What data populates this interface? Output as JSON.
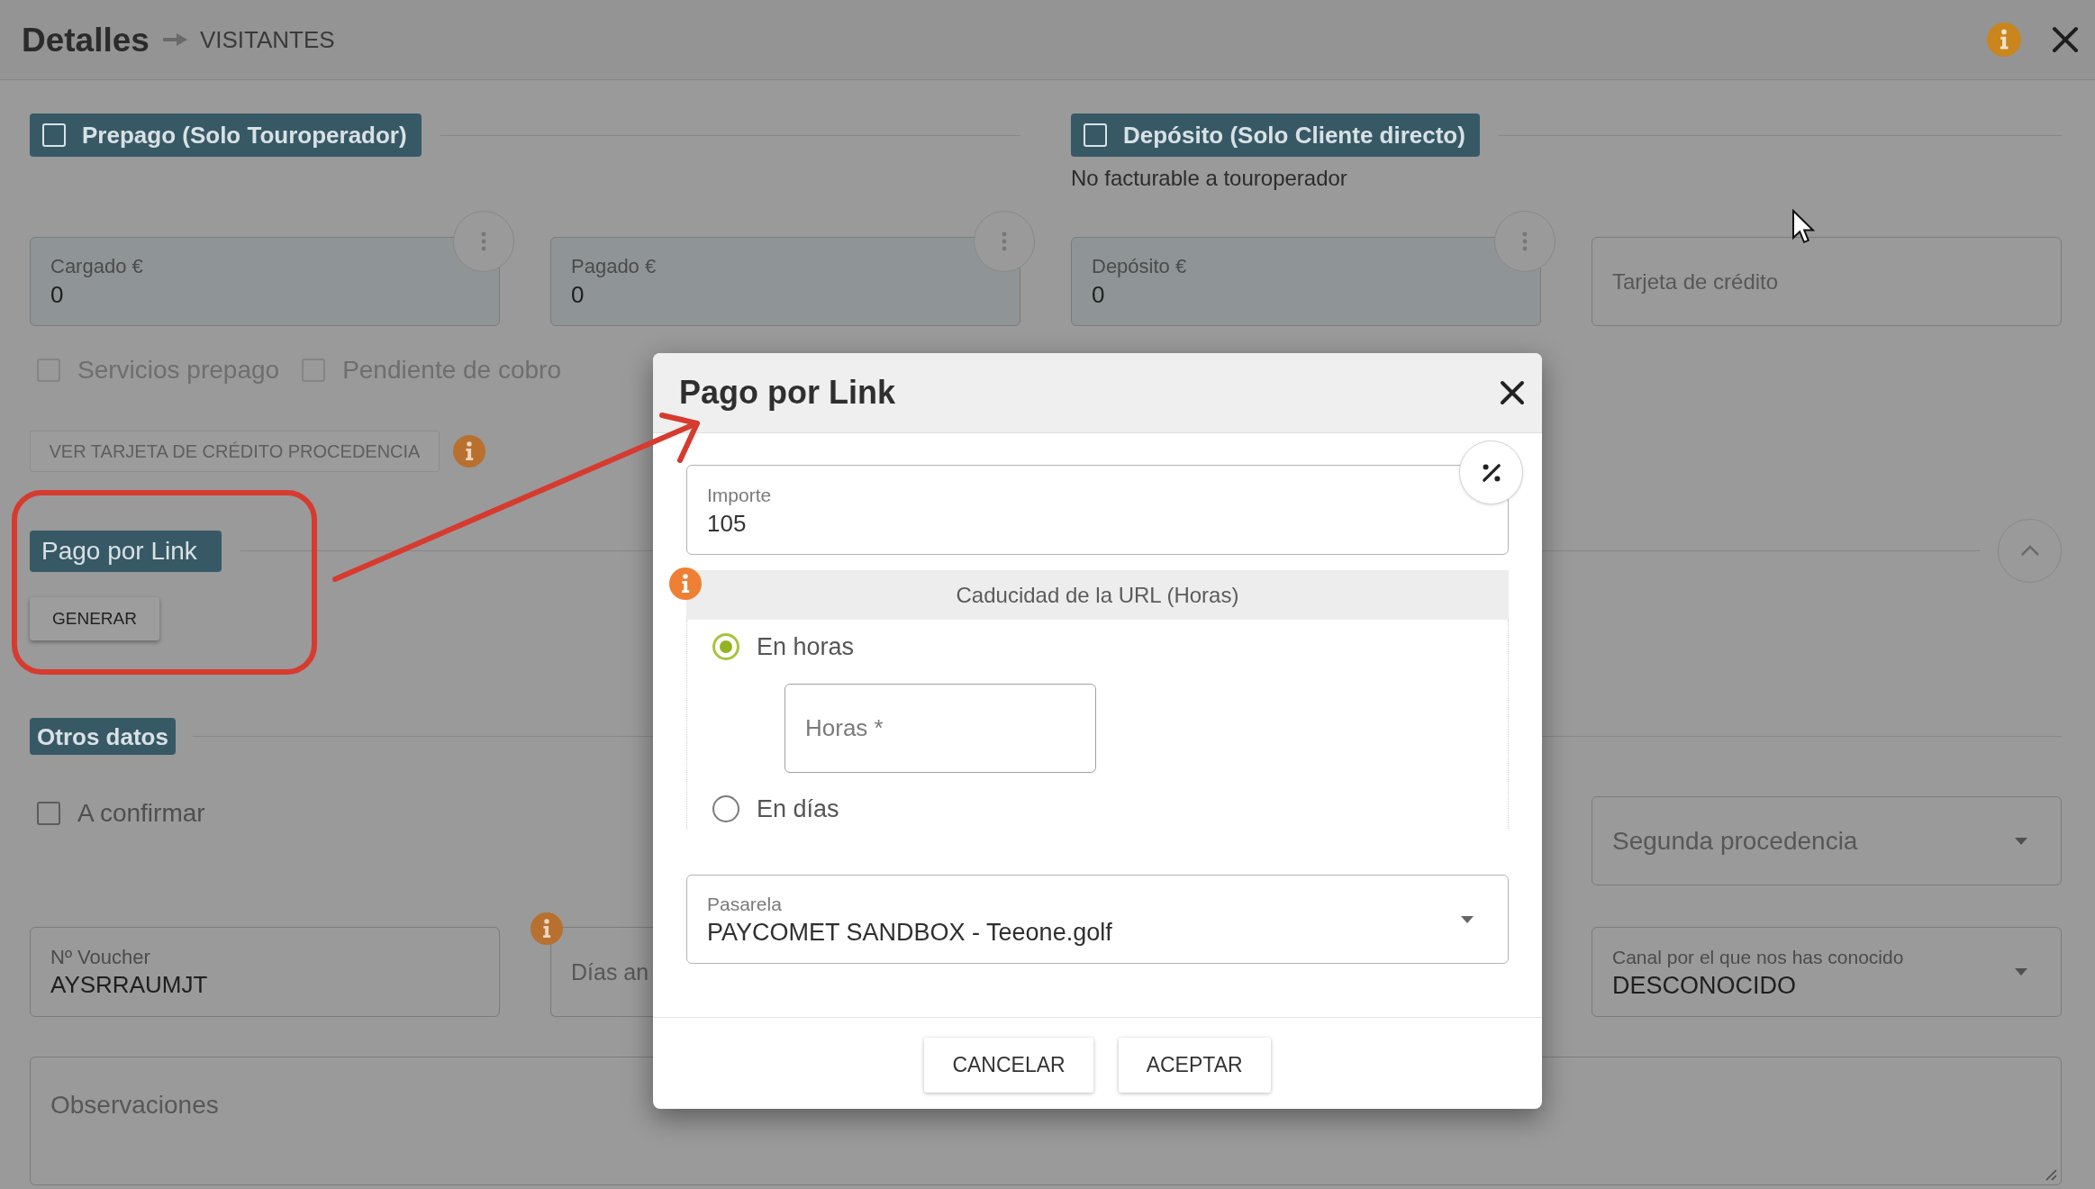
{
  "header": {
    "title": "Detalles",
    "breadcrumb": "VISITANTES"
  },
  "prepago": {
    "label": "Prepago (Solo Touroperador)",
    "checked": false
  },
  "deposito": {
    "label": "Depósito (Solo Cliente directo)",
    "checked": false,
    "note": "No facturable a touroperador"
  },
  "amount_fields": [
    {
      "kind": "filled",
      "label": "Cargado €",
      "value": "0"
    },
    {
      "kind": "filled",
      "label": "Pagado €",
      "value": "0"
    },
    {
      "kind": "filled",
      "label": "Depósito €",
      "value": "0"
    },
    {
      "kind": "input",
      "placeholder": "Tarjeta de crédito"
    }
  ],
  "prepago_options": [
    {
      "label": "Servicios prepago",
      "checked": false,
      "disabled": true
    },
    {
      "label": "Pendiente de cobro",
      "checked": false,
      "disabled": true
    }
  ],
  "card_button": {
    "label": "VER TARJETA DE CRÉDITO PROCEDENCIA",
    "disabled": true
  },
  "link_section": {
    "title": "Pago por Link",
    "expanded": true,
    "button": "GENERAR"
  },
  "other_section": {
    "title": "Otros datos",
    "to_confirm": {
      "label": "A confirmar",
      "checked": false,
      "disabled": false
    },
    "second_origin": {
      "placeholder": "Segunda procedencia"
    },
    "voucher": {
      "label": "Nº Voucher",
      "value": "AYSRRAUMJT"
    },
    "days": {
      "placeholder": "Días an"
    },
    "channel": {
      "label": "Canal por el que nos has conocido",
      "value": "DESCONOCIDO"
    },
    "notes": {
      "placeholder": "Observaciones"
    }
  },
  "dialog": {
    "title": "Pago por Link",
    "amount": {
      "label": "Importe",
      "value": "105"
    },
    "expiry": {
      "title": "Caducidad de la URL (Horas)",
      "options": [
        {
          "label": "En horas",
          "selected": true
        },
        {
          "label": "En días",
          "selected": false
        }
      ],
      "hours_field": {
        "placeholder": "Horas *"
      }
    },
    "gateway": {
      "label": "Pasarela",
      "value": "PAYCOMET SANDBOX - Teeone.golf"
    },
    "buttons": [
      {
        "label": "CANCELAR"
      },
      {
        "label": "ACEPTAR"
      }
    ]
  }
}
